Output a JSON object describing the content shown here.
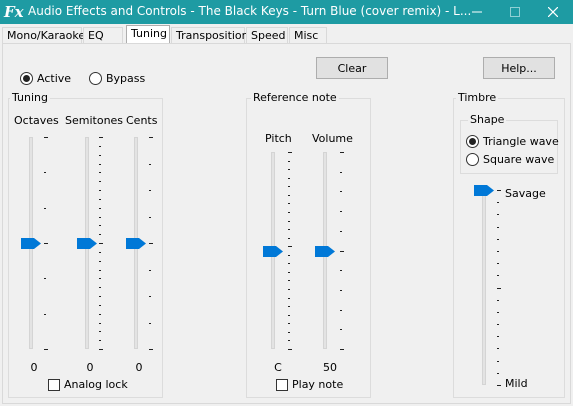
{
  "window": {
    "title": "Audio Effects and Controls - The Black Keys - Turn Blue (cover remix) - L...",
    "icon": "Fx",
    "accent_color": "#1e9ba3"
  },
  "tabs": [
    {
      "label": "Mono/Karaoke"
    },
    {
      "label": "EQ"
    },
    {
      "label": "Tuning",
      "active": true
    },
    {
      "label": "Transposition"
    },
    {
      "label": "Speed"
    },
    {
      "label": "Misc"
    }
  ],
  "mode": {
    "active_label": "Active",
    "bypass_label": "Bypass",
    "selected": "Active"
  },
  "buttons": {
    "clear": "Clear",
    "help": "Help..."
  },
  "tuning": {
    "title": "Tuning",
    "octaves": {
      "label": "Octaves",
      "value": "0"
    },
    "semitones": {
      "label": "Semitones",
      "value": "0"
    },
    "cents": {
      "label": "Cents",
      "value": "0"
    },
    "analog_lock_label": "Analog lock",
    "analog_lock_checked": false
  },
  "reference_note": {
    "title": "Reference note",
    "pitch": {
      "label": "Pitch",
      "value": "C"
    },
    "volume": {
      "label": "Volume",
      "value": "50"
    },
    "play_note_label": "Play note",
    "play_note_checked": false
  },
  "timbre": {
    "title": "Timbre",
    "shape": {
      "title": "Shape",
      "triangle_label": "Triangle wave",
      "square_label": "Square wave",
      "selected": "Triangle wave"
    },
    "top_label": "Savage",
    "bottom_label": "Mild",
    "level": 0
  },
  "slider_color": "#0078d7"
}
